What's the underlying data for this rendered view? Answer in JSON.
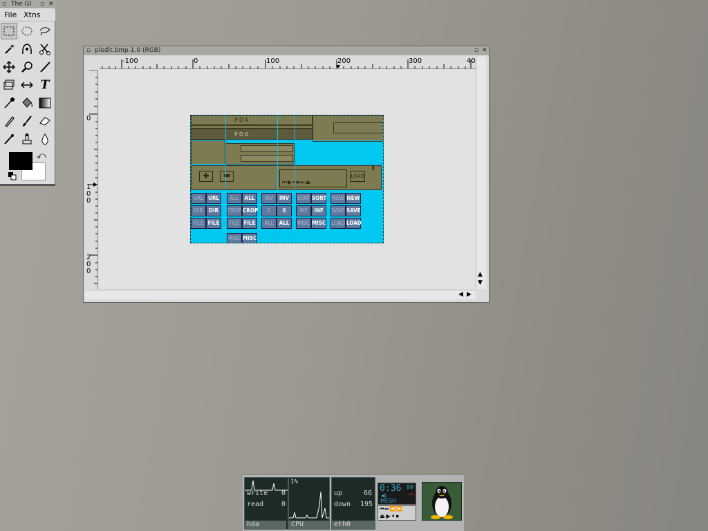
{
  "toolbox": {
    "title": "The GI",
    "menu": {
      "file": "File",
      "xtns": "Xtns"
    },
    "tools": [
      "rect-select",
      "ellipse-select",
      "lasso",
      "fuzzy-select",
      "bezier-select",
      "intelligent-scissors",
      "move",
      "magnify",
      "crop",
      "transform",
      "flip",
      "text",
      "color-picker",
      "bucket-fill",
      "gradient",
      "pencil",
      "paintbrush",
      "eraser",
      "airbrush",
      "clone",
      "convolve"
    ],
    "fg_color": "#000000",
    "bg_color": "#ffffff"
  },
  "imagewindow": {
    "title": "pledit.bmp-1.0 (RGB)",
    "ruler_top": [
      "-100",
      "0",
      "100",
      "200",
      "300",
      "40"
    ],
    "ruler_left": [
      "0",
      "1",
      "0",
      "0",
      "2",
      "0",
      "0"
    ]
  },
  "pda": {
    "title1": "PDA",
    "title2": "PDA",
    "load": "LOAD",
    "buttons": [
      [
        "URL",
        "URL",
        "ALL",
        "ALL",
        "INV",
        "INV",
        "SORT",
        "SORT",
        "NEW",
        "NEW"
      ],
      [
        "DIR",
        "DIR",
        "CROP",
        "CROP",
        "0",
        "0",
        "INF",
        "INF",
        "SAVE",
        "SAVE"
      ],
      [
        "FILE",
        "FILE",
        "FILE",
        "FILE",
        "ALL",
        "ALL",
        "MISC",
        "MISC",
        "LOAD",
        "LOAD"
      ],
      [
        "MISC",
        "MISC"
      ]
    ]
  },
  "dock": {
    "hda": {
      "write_label": "write",
      "write_val": "0",
      "read_label": "read",
      "read_val": "0",
      "name": "hda"
    },
    "cpu": {
      "percent": "1%",
      "name": "CPU"
    },
    "net": {
      "up_label": "up",
      "up_val": "66",
      "down_label": "down",
      "down_val": "195",
      "name": "eth0"
    },
    "player": {
      "time": "0:36",
      "secs": "00",
      "title": "MESH"
    }
  },
  "colors": {
    "pda_bg": "#00c8f0",
    "pda_olive": "#7e7a52",
    "pda_button": "#5f7aa0"
  }
}
